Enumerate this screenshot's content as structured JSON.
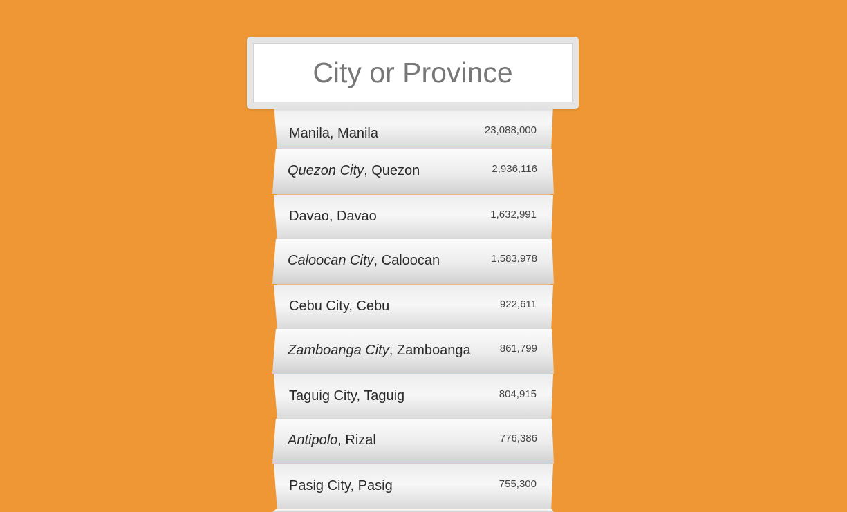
{
  "search": {
    "placeholder": "City or Province"
  },
  "results": [
    {
      "city": "Manila",
      "province": "Manila",
      "population": "23,088,000"
    },
    {
      "city": "Quezon City",
      "province": "Quezon",
      "population": "2,936,116"
    },
    {
      "city": "Davao",
      "province": "Davao",
      "population": "1,632,991"
    },
    {
      "city": "Caloocan City",
      "province": "Caloocan",
      "population": "1,583,978"
    },
    {
      "city": "Cebu City",
      "province": "Cebu",
      "population": "922,611"
    },
    {
      "city": "Zamboanga City",
      "province": "Zamboanga",
      "population": "861,799"
    },
    {
      "city": "Taguig City",
      "province": "Taguig",
      "population": "804,915"
    },
    {
      "city": "Antipolo",
      "province": "Rizal",
      "population": "776,386"
    },
    {
      "city": "Pasig City",
      "province": "Pasig",
      "population": "755,300"
    }
  ],
  "colors": {
    "background": "#ee9734",
    "input_text": "#777777"
  }
}
